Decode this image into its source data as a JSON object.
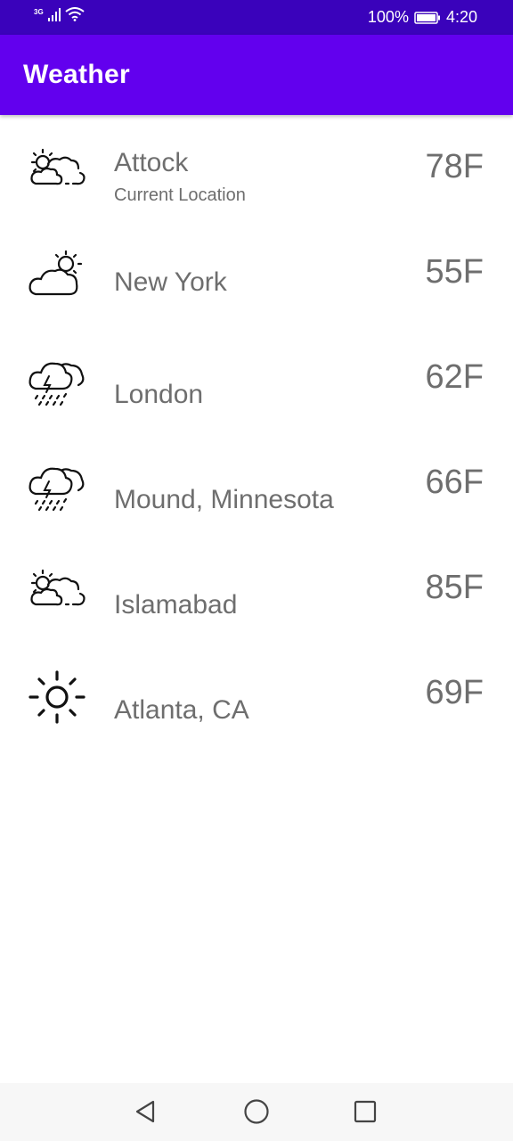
{
  "status_bar": {
    "network": "3G",
    "battery": "100%",
    "time": "4:20"
  },
  "app_bar": {
    "title": "Weather"
  },
  "locations": [
    {
      "city": "Attock",
      "subtitle": "Current Location",
      "temp": "78F",
      "icon": "partly-cloudy-icon"
    },
    {
      "city": "New York",
      "subtitle": "",
      "temp": "55F",
      "icon": "cloudy-sun-icon"
    },
    {
      "city": "London",
      "subtitle": "",
      "temp": "62F",
      "icon": "thunderstorm-icon"
    },
    {
      "city": "Mound, Minnesota",
      "subtitle": "",
      "temp": "66F",
      "icon": "thunderstorm-icon"
    },
    {
      "city": "Islamabad",
      "subtitle": "",
      "temp": "85F",
      "icon": "partly-cloudy-icon"
    },
    {
      "city": "Atlanta, CA",
      "subtitle": "",
      "temp": "69F",
      "icon": "sunny-icon"
    }
  ],
  "nav_bar": {
    "buttons": [
      "back-icon",
      "home-icon",
      "recents-icon"
    ]
  },
  "colors": {
    "status_bar": "#3a02bb",
    "app_bar": "#6200ee",
    "text": "#6e6e6e"
  }
}
